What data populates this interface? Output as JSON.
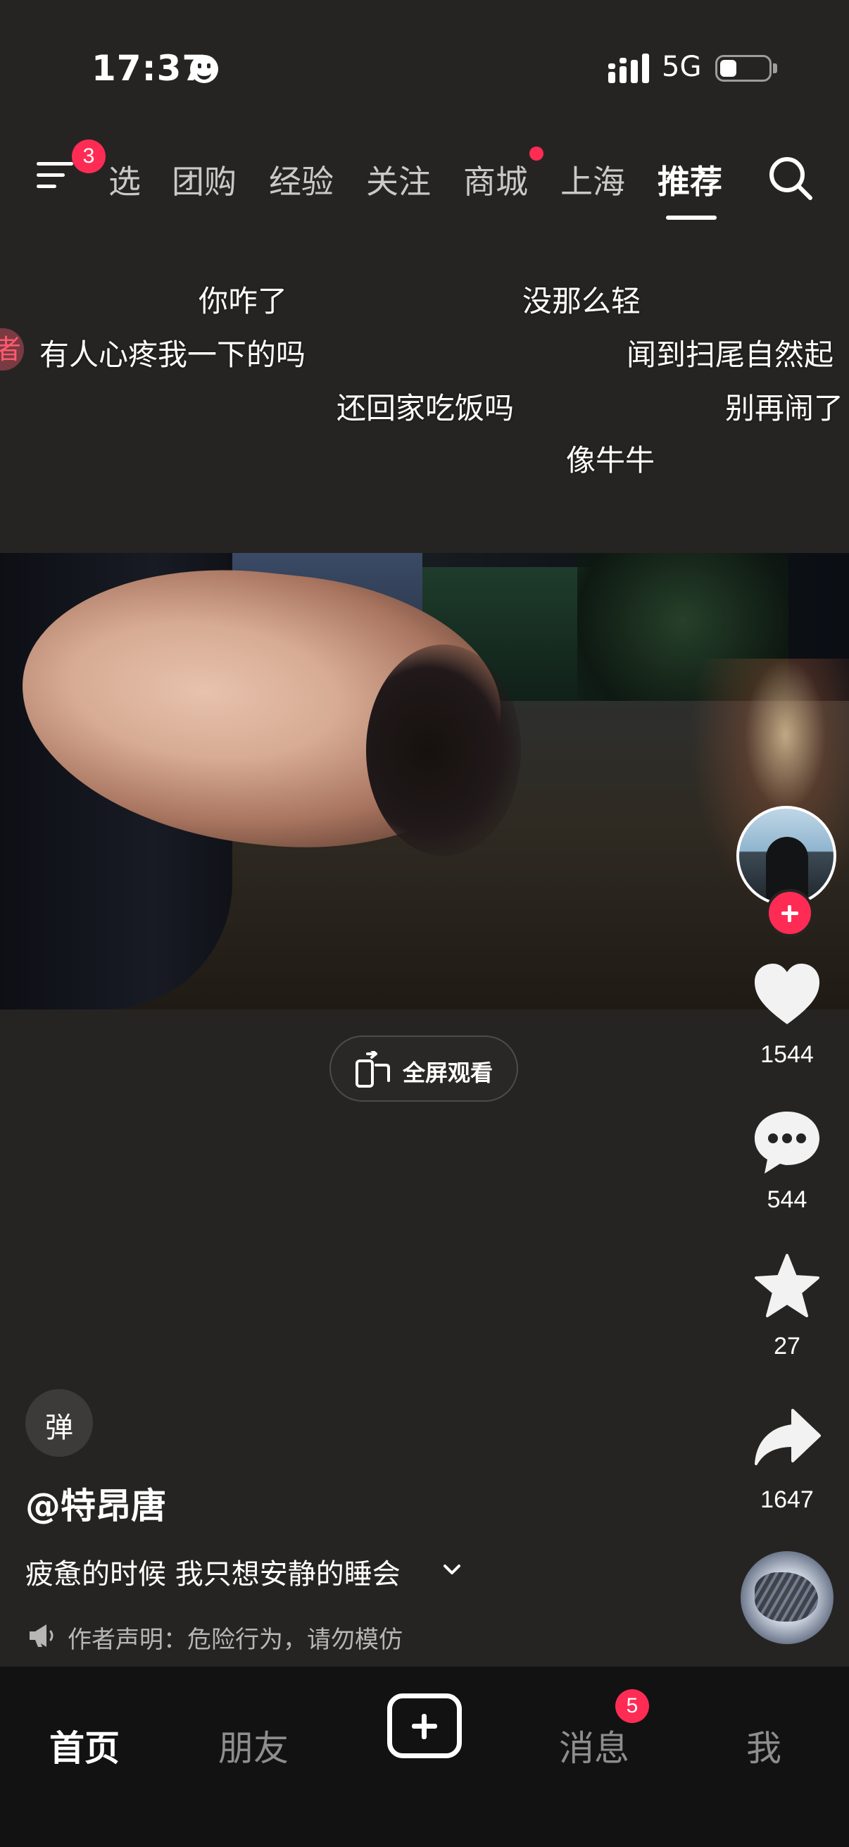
{
  "status_bar": {
    "time": "17:37",
    "network": "5G",
    "battery_level": 0.35
  },
  "top_nav": {
    "menu_badge": "3",
    "tabs": [
      {
        "label": "选",
        "active": false
      },
      {
        "label": "团购",
        "active": false
      },
      {
        "label": "经验",
        "active": false
      },
      {
        "label": "关注",
        "active": false
      },
      {
        "label": "商城",
        "active": false,
        "dot": true
      },
      {
        "label": "上海",
        "active": false
      },
      {
        "label": "推荐",
        "active": true
      }
    ]
  },
  "danmaku": {
    "tag": "者",
    "items": [
      "你咋了",
      "没那么轻",
      "有人心疼我一下的吗",
      "闻到扫尾自然起",
      "还回家吃饭吗",
      "别再闹了",
      "像牛牛"
    ]
  },
  "player": {
    "fullscreen_label": "全屏观看"
  },
  "actions": {
    "likes": "1544",
    "comments": "544",
    "favorites": "27",
    "shares": "1647"
  },
  "post": {
    "danmaku_toggle": "弹",
    "author": "@特昂唐",
    "caption": "疲惫的时候 我只想安静的睡会",
    "disclaimer": "作者声明：危险行为，请勿模仿"
  },
  "bottom_nav": {
    "home": "首页",
    "friends": "朋友",
    "messages": "消息",
    "messages_badge": "5",
    "me": "我"
  },
  "colors": {
    "accent": "#fe2c55",
    "background": "#262422",
    "bottom_bar": "#121212"
  }
}
